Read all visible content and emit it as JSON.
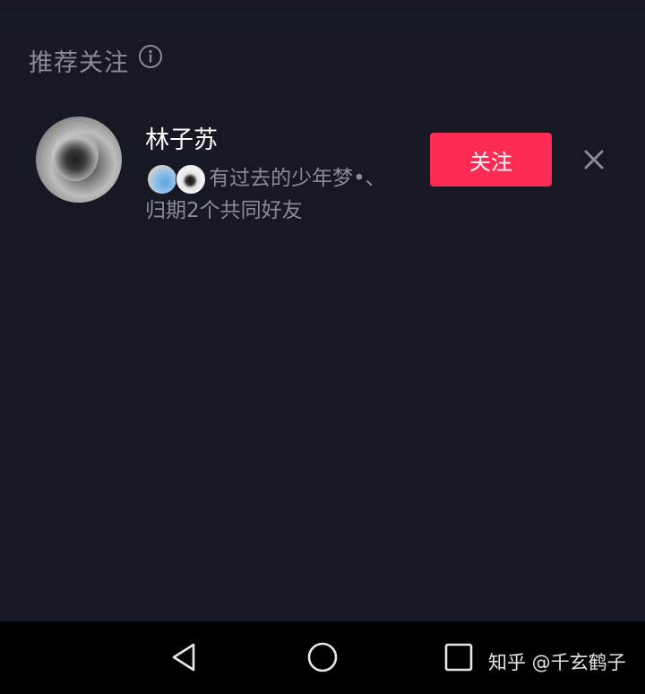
{
  "section": {
    "title": "推荐关注",
    "info_icon": "info-icon"
  },
  "user": {
    "name": "林子苏",
    "mutual_line1": "有过去的少年梦•、",
    "mutual_line2": "归期2个共同好友"
  },
  "follow_button": {
    "label": "关注",
    "color": "#fe2c55"
  },
  "dismiss_icon": "close-icon",
  "nav_bar": {
    "back_icon": "back-triangle-icon",
    "home_icon": "home-circle-icon",
    "recent_icon": "recent-apps-square-icon"
  },
  "watermark": "知乎 @千玄鹤子",
  "colors": {
    "background": "#161823",
    "secondary_text": "#8a8b93",
    "accent": "#fe2c55"
  }
}
